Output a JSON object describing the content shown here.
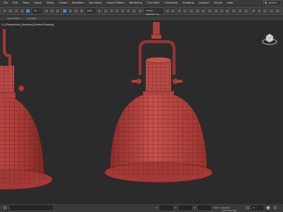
{
  "menu": {
    "items": [
      "File",
      "Edit",
      "Tools",
      "Group",
      "Views",
      "Create",
      "Modifiers",
      "Animation",
      "Graph Editors",
      "Rendering",
      "Civil View",
      "Customize",
      "Scripting",
      "Content",
      "Arnold",
      "Help"
    ]
  },
  "search": {
    "placeholder": "Search"
  },
  "toolbar": {
    "filter_value": "All",
    "view_value": "View",
    "selection_set_placeholder": "Create Selection Se"
  },
  "ribbon": {
    "tabs": [
      "Object Paint",
      "Populate"
    ]
  },
  "viewport": {
    "label": "[+] [Perspective] [Standard] [Default Shading]",
    "model_color": "#b8423f",
    "wire_color": "#6e1f1d",
    "background": "#2b2b2b"
  },
  "status": {
    "x_label": "X:",
    "y_label": "Y:",
    "z_label": "Z:",
    "grid_text": "Grid = 10,0mm",
    "time_tag": "Add Time Tag",
    "frame_value": "0"
  }
}
